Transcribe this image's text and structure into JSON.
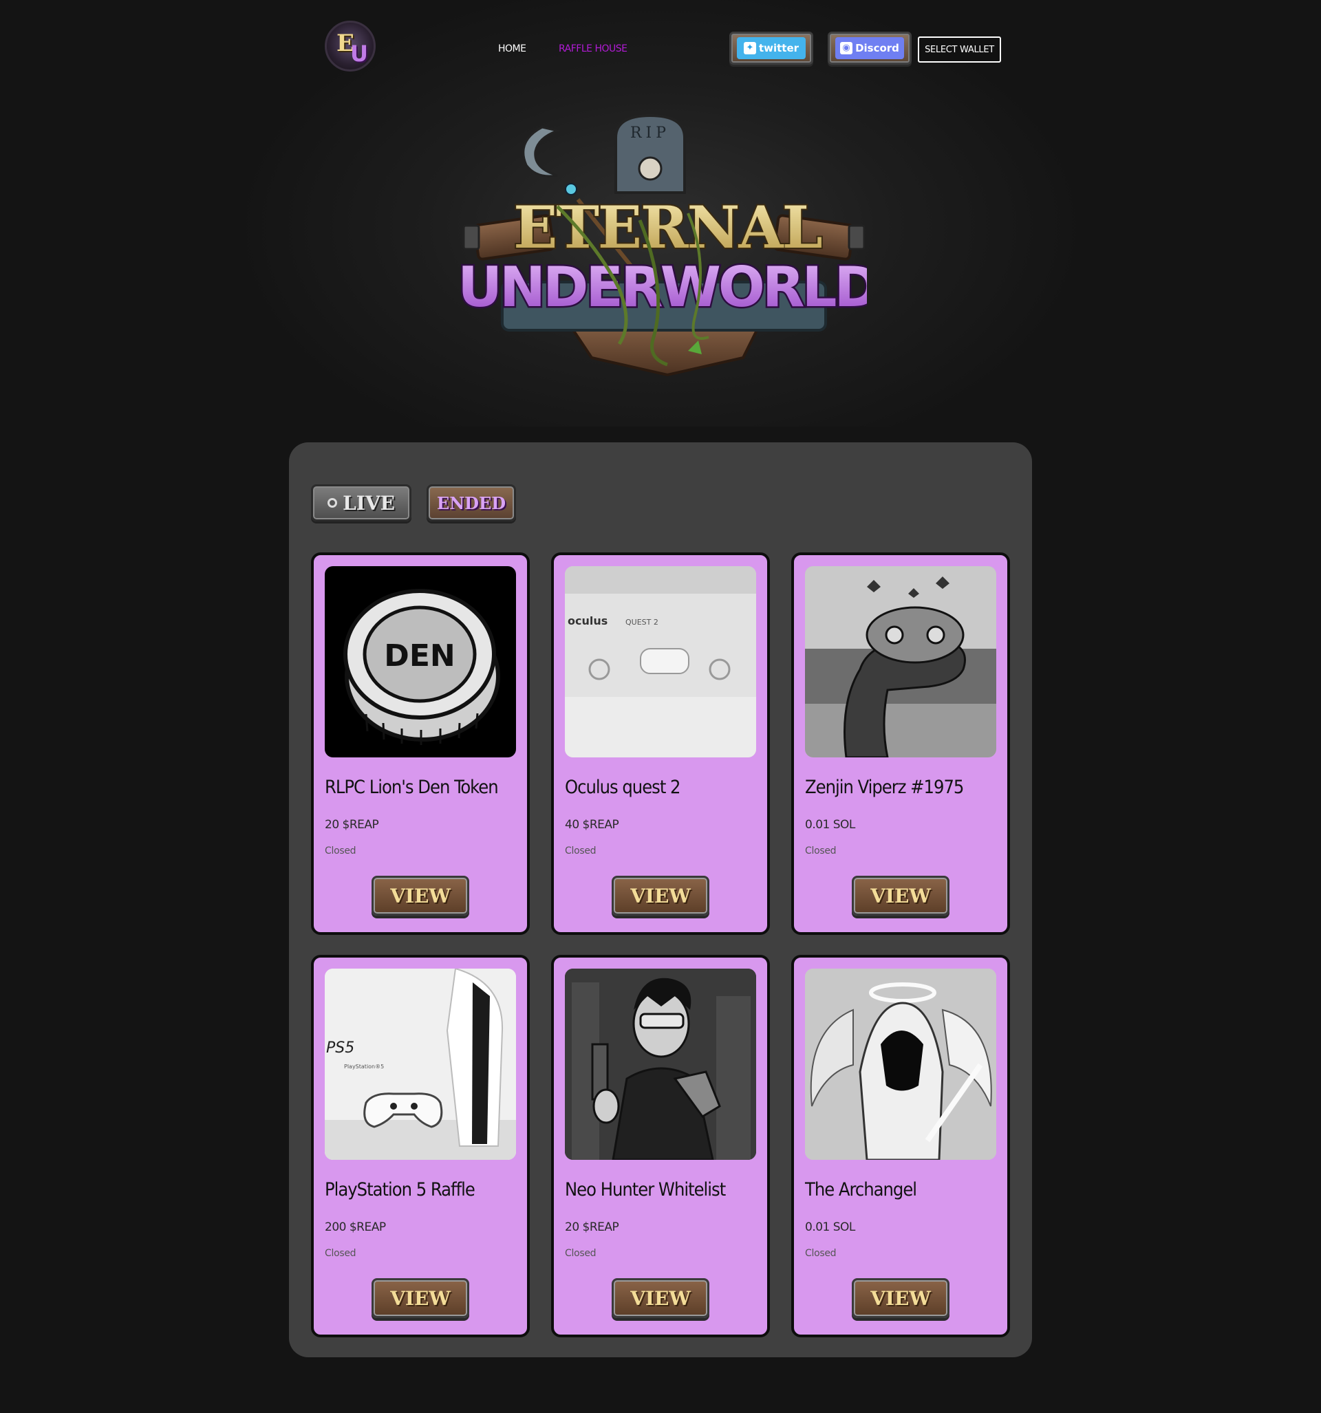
{
  "header": {
    "logo_text": "EU",
    "nav": {
      "home": "Home",
      "raffle_house": "Raffle House"
    },
    "twitter_label": "twitter",
    "discord_label": "Discord",
    "select_wallet": "Select Wallet"
  },
  "hero": {
    "title_top": "ETERNAL",
    "title_bottom": "UNDERWORLD",
    "tombstone_text": "RIP"
  },
  "tabs": {
    "live": "LIVE",
    "ended": "ENDED"
  },
  "colors": {
    "card_bg": "#d898ee",
    "raffle_nav": "#b21bd6",
    "panel": "#404040",
    "page_bg": "#141414"
  },
  "cards": [
    {
      "title": "RLPC Lion's Den Token",
      "price": "20 $REAP",
      "status": "Closed",
      "button": "VIEW",
      "image": "den-coin-image",
      "image_text": "DEN"
    },
    {
      "title": "Oculus quest 2",
      "price": "40 $REAP",
      "status": "Closed",
      "button": "VIEW",
      "image": "oculus-box-image",
      "image_text": "oculus",
      "image_subtext": "QUEST 2"
    },
    {
      "title": "Zenjin Viperz #1975",
      "price": "0.01 SOL",
      "status": "Closed",
      "button": "VIEW",
      "image": "pixel-serpent-image"
    },
    {
      "title": "PlayStation 5 Raffle",
      "price": "200 $REAP",
      "status": "Closed",
      "button": "VIEW",
      "image": "ps5-console-image",
      "image_text": "PS5",
      "image_subtext": "PlayStation®5"
    },
    {
      "title": "Neo Hunter Whitelist",
      "price": "20 $REAP",
      "status": "Closed",
      "button": "VIEW",
      "image": "cyberpunk-hunter-image"
    },
    {
      "title": "The Archangel",
      "price": "0.01 SOL",
      "status": "Closed",
      "button": "VIEW",
      "image": "archangel-image"
    }
  ]
}
